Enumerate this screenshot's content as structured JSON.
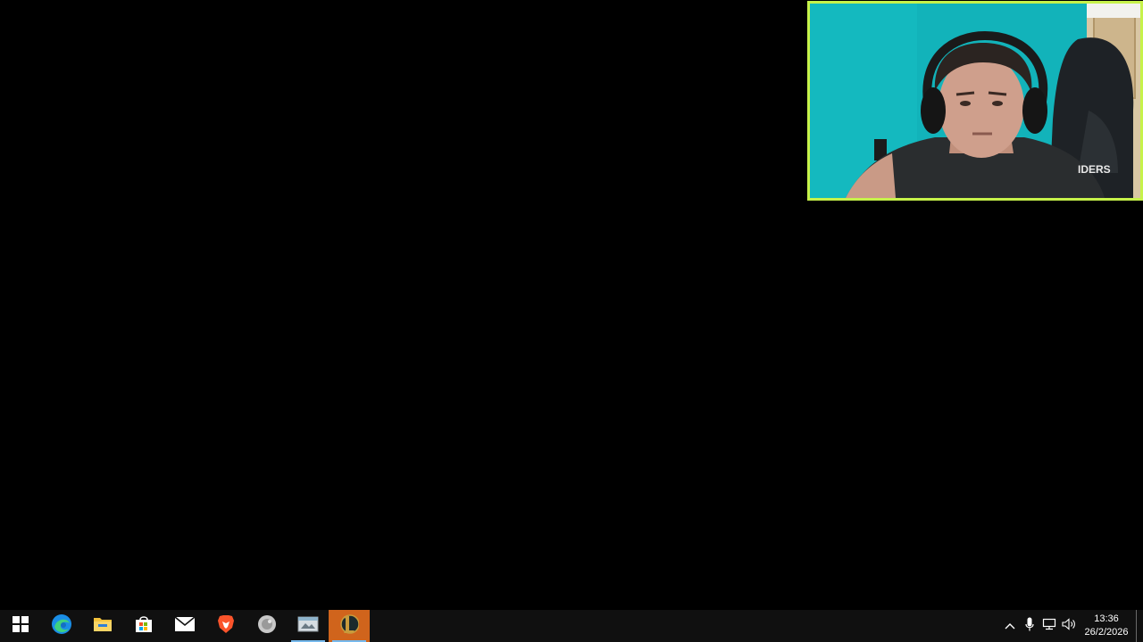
{
  "webcam": {
    "label": "webcam overlay",
    "frame_color": "#c6f24a",
    "background_color": "#10b4bc"
  },
  "taskbar": {
    "background_color": "#101010",
    "pinned": [
      {
        "name": "start-button",
        "icon": "windows-logo-icon"
      },
      {
        "name": "edge-button",
        "icon": "edge-icon"
      },
      {
        "name": "file-explorer-button",
        "icon": "folder-icon"
      },
      {
        "name": "store-button",
        "icon": "store-icon"
      },
      {
        "name": "mail-button",
        "icon": "mail-icon"
      },
      {
        "name": "brave-button",
        "icon": "brave-lion-icon"
      },
      {
        "name": "app-button",
        "icon": "grey-circle-app-icon"
      },
      {
        "name": "app-window-button",
        "icon": "window-app-icon"
      },
      {
        "name": "league-client-button",
        "icon": "league-of-legends-icon"
      }
    ],
    "tray": {
      "icons": [
        "chevron-up-icon",
        "microphone-icon",
        "network-icon",
        "volume-icon"
      ],
      "time": "13:36",
      "date": "26/2/2026"
    }
  }
}
